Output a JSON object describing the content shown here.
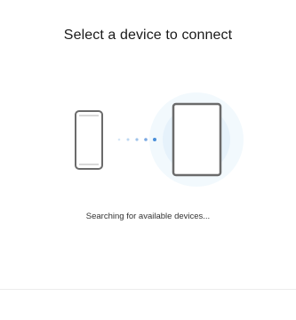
{
  "header": {
    "title": "Select a device to connect"
  },
  "status": {
    "text": "Searching for available devices..."
  },
  "illustration": {
    "source_device": "phone-icon",
    "target_device": "tablet-icon",
    "connection": "dotted-connection-icon",
    "accent_color": "#4a8fd9",
    "glow_color": "#e6f2fb"
  }
}
